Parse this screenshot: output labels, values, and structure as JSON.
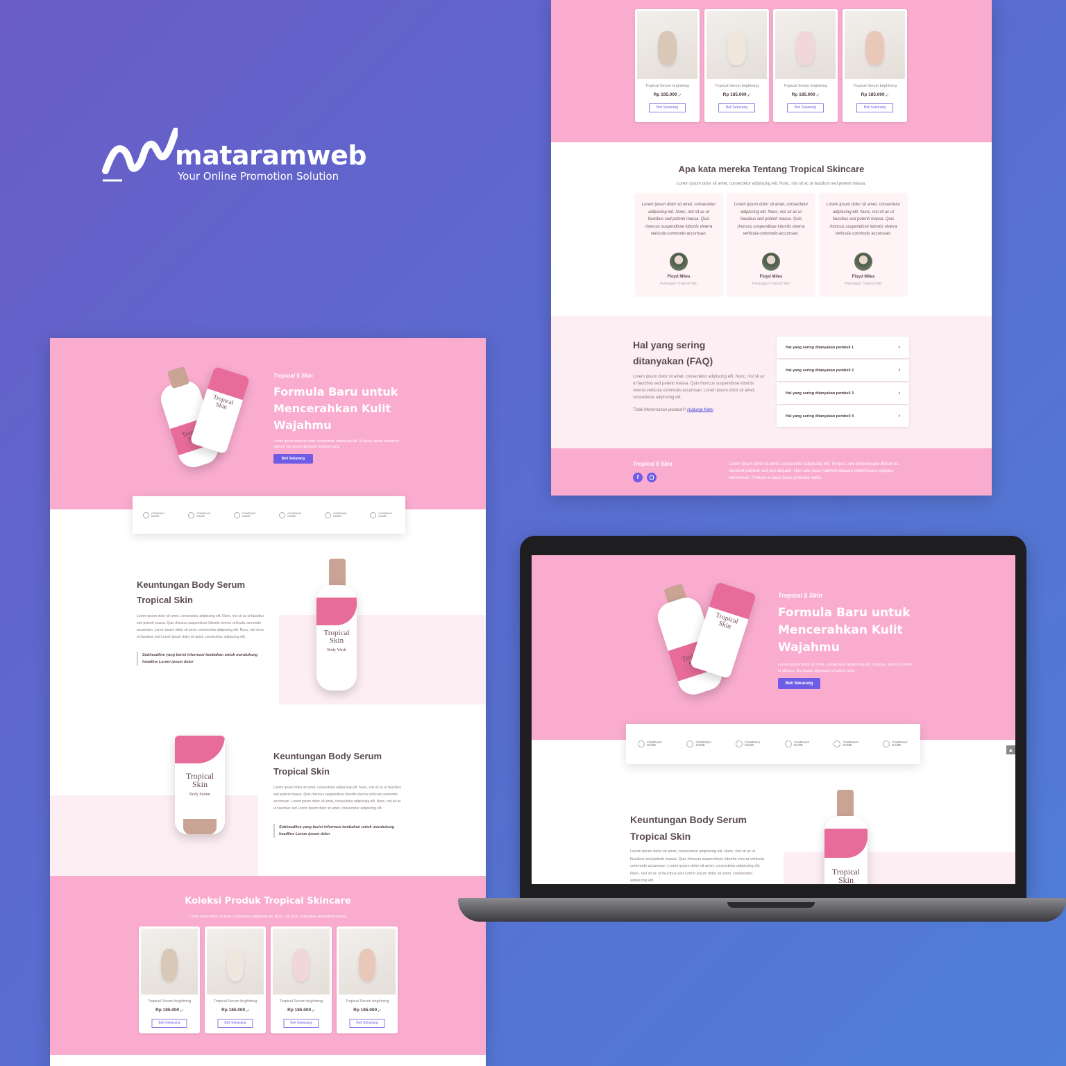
{
  "brand": {
    "name": "mataramweb",
    "tagline": "Your Online Promotion Solution"
  },
  "colors": {
    "background": "#5a6cd0",
    "pink": "#f9acce",
    "light_pink": "#fdeef3",
    "button": "#6e5ce6"
  },
  "hero": {
    "brand_small": "Tropical § Skin",
    "title_l1": "Formula Baru untuk",
    "title_l2": "Mencerahkan Kulit",
    "title_l3": "Wajahmu",
    "subtitle": "Lorem ipsum dolor sit amet, consectetur adipiscing elit. Ut lacus, auctor pretium et ultrices. Dui ipsum dignissim tincidunt urna.",
    "cta": "Beli Sekarang"
  },
  "logos": [
    "COMPANY NAME",
    "COMPANY NAME",
    "COMPANY NAME",
    "COMPANY NAME",
    "COMPANY NAME",
    "COMPANY NAME"
  ],
  "feature1": {
    "title_l1": "Keuntungan Body Serum",
    "title_l2": "Tropical Skin",
    "body": "Lorem ipsum dolor sit amet, consectetur adipiscing elit. Nunc, nisl sit ac ut faucibus sed potenti massa. Quis rhoncus suspendisse lobortis viverra vehicula commodo accumsan. Lorem ipsum dolor sit amet, consectetur adipiscing elit. Nunc, nisl sit ac ut faucibus sed Lorem ipsum dolor sit amet, consectetur adipiscing elit.",
    "quote": "Subheadline yang berisi informasi tambahan untuk mendukung headline Lorem ipsum dolor"
  },
  "feature2": {
    "title_l1": "Keuntungan Body Serum",
    "title_l2": "Tropical Skin",
    "body": "Lorem ipsum dolor sit amet, consectetur adipiscing elit. Nunc, nisl sit ac ut faucibus sed potenti massa. Quis rhoncus suspendisse lobortis viverra vehicula commodo accumsan. Lorem ipsum dolor sit amet, consectetur adipiscing elit. Nunc, nisl sit ac ut faucibus sed Lorem ipsum dolor sit amet, consectetur adipiscing elit.",
    "quote": "Subheadline yang berisi informasi tambahan untuk mendukung headline Lorem ipsum dolor"
  },
  "bottle_label": {
    "l1": "Tropical",
    "l2": "Skin",
    "l3": "Body Wash",
    "l4": "Body Serum"
  },
  "collection": {
    "title": "Koleksi Produk Tropical Skincare",
    "subtitle": "Lorem ipsum dolor sit amet, consectetur adipiscing elit. Nunc, nisl sit ac ut faucibus sed potenti massa.",
    "products": [
      {
        "name": "Tropical Serum brightning",
        "price": "Rp 185.000 ,-",
        "cta": "Beli Sekarang"
      },
      {
        "name": "Tropical Serum brightning",
        "price": "Rp 185.000 ,-",
        "cta": "Beli Sekarang"
      },
      {
        "name": "Tropical Serum brightning",
        "price": "Rp 185.000 ,-",
        "cta": "Beli Sekarang"
      },
      {
        "name": "Tropical Serum brightning",
        "price": "Rp 185.000 ,-",
        "cta": "Beli Sekarang"
      }
    ]
  },
  "testimonials": {
    "title": "Apa kata mereka Tentang Tropical Skincare",
    "subtitle": "Lorem ipsum dolor sit amet, consectetur adipiscing elit. Nunc, nisl sit ac ut faucibus sed potenti massa.",
    "items": [
      {
        "text": "Lorem ipsum dolor sit amet, consectetur adipiscing elit. Nunc, nisl sit ac ut faucibus sed potenti massa. Quis rhoncus suspendisse lobortis viverra vehicula commodo accumsan.",
        "name": "Floyd Miles",
        "role": "Pelanggan Tropical Skin"
      },
      {
        "text": "Lorem ipsum dolor sit amet, consectetur adipiscing elit. Nunc, nisl sit ac ut faucibus sed potenti massa. Quis rhoncus suspendisse lobortis viverra vehicula commodo accumsan.",
        "name": "Floyd Miles",
        "role": "Pelanggan Tropical Skin"
      },
      {
        "text": "Lorem ipsum dolor sit amet, consectetur adipiscing elit. Nunc, nisl sit ac ut faucibus sed potenti massa. Quis rhoncus suspendisse lobortis viverra vehicula commodo accumsan.",
        "name": "Floyd Miles",
        "role": "Pelanggan Tropical Skin"
      }
    ]
  },
  "faq": {
    "title_l1": "Hal yang sering",
    "title_l2": "ditanyakan (FAQ)",
    "body": "Lorem ipsum dolor sit amet, consectetur adipiscing elit. Nunc, nisl sit ac ut faucibus sed potenti massa. Quis rhoncus suspendisse lobortis viverra vehicula commodo accumsan. Lorem ipsum dolor sit amet, consectetur adipiscing elit.",
    "not_found": "Tidak Menemukan jawaban?",
    "contact": "Hubungi Kami",
    "items": [
      "Hal yang sering ditanyakan pembeli 1",
      "Hal yang sering ditanyakan pembeli 2",
      "Hal yang sering ditanyakan pembeli 3",
      "Hal yang sering ditanyakan pembeli 4"
    ]
  },
  "footer": {
    "brand": "Tropical § Skin",
    "text": "Lorem ipsum dolor sit amet, consectetur adipiscing elit. Tempus, sed pellentesque dictum ac, tincidunt pulvinar sed sed aliquam. Non odio lacus habitant aliquam pellentesque egestas elementum. Pretium ut lacus turpis pharetra mollis.",
    "icons": [
      "facebook-icon",
      "instagram-icon"
    ]
  }
}
